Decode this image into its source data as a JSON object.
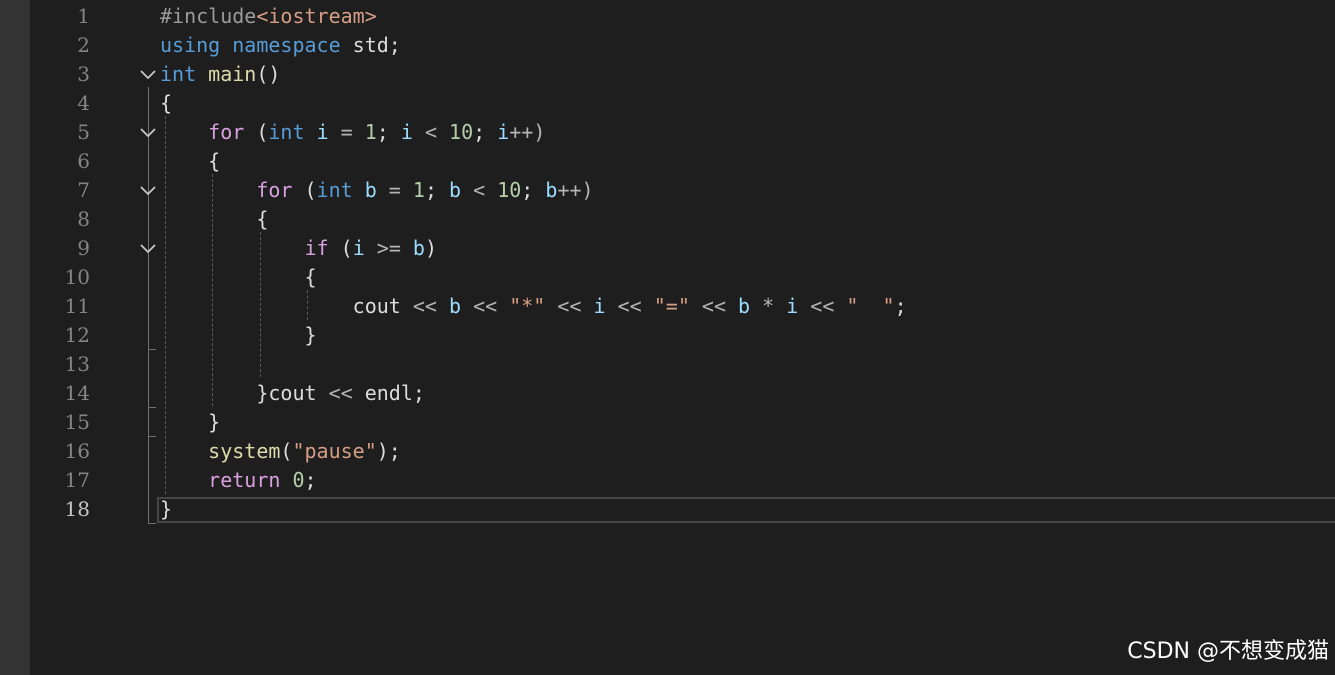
{
  "editor": {
    "active_line": 18,
    "line_numbers": [
      "1",
      "2",
      "3",
      "4",
      "5",
      "6",
      "7",
      "8",
      "9",
      "10",
      "11",
      "12",
      "13",
      "14",
      "15",
      "16",
      "17",
      "18"
    ],
    "lines": [
      [
        {
          "t": "#include",
          "c": "inc"
        },
        {
          "t": "<iostream>",
          "c": "str"
        }
      ],
      [
        {
          "t": "using",
          "c": "kw"
        },
        {
          "t": " ",
          "c": "plain"
        },
        {
          "t": "namespace",
          "c": "kw"
        },
        {
          "t": " std;",
          "c": "plain"
        }
      ],
      [
        {
          "t": "int",
          "c": "kw"
        },
        {
          "t": " ",
          "c": "plain"
        },
        {
          "t": "main",
          "c": "fn"
        },
        {
          "t": "()",
          "c": "punc"
        }
      ],
      [
        {
          "t": "{",
          "c": "punc"
        }
      ],
      [
        {
          "t": "    ",
          "c": "plain"
        },
        {
          "t": "for",
          "c": "ctl"
        },
        {
          "t": " (",
          "c": "punc"
        },
        {
          "t": "int",
          "c": "kw"
        },
        {
          "t": " ",
          "c": "plain"
        },
        {
          "t": "i",
          "c": "var"
        },
        {
          "t": " = ",
          "c": "op"
        },
        {
          "t": "1",
          "c": "num"
        },
        {
          "t": "; ",
          "c": "punc"
        },
        {
          "t": "i",
          "c": "var"
        },
        {
          "t": " < ",
          "c": "op"
        },
        {
          "t": "10",
          "c": "num"
        },
        {
          "t": "; ",
          "c": "punc"
        },
        {
          "t": "i",
          "c": "var"
        },
        {
          "t": "++)",
          "c": "op"
        }
      ],
      [
        {
          "t": "    {",
          "c": "punc"
        }
      ],
      [
        {
          "t": "        ",
          "c": "plain"
        },
        {
          "t": "for",
          "c": "ctl"
        },
        {
          "t": " (",
          "c": "punc"
        },
        {
          "t": "int",
          "c": "kw"
        },
        {
          "t": " ",
          "c": "plain"
        },
        {
          "t": "b",
          "c": "var"
        },
        {
          "t": " = ",
          "c": "op"
        },
        {
          "t": "1",
          "c": "num"
        },
        {
          "t": "; ",
          "c": "punc"
        },
        {
          "t": "b",
          "c": "var"
        },
        {
          "t": " < ",
          "c": "op"
        },
        {
          "t": "10",
          "c": "num"
        },
        {
          "t": "; ",
          "c": "punc"
        },
        {
          "t": "b",
          "c": "var"
        },
        {
          "t": "++)",
          "c": "op"
        }
      ],
      [
        {
          "t": "        {",
          "c": "punc"
        }
      ],
      [
        {
          "t": "            ",
          "c": "plain"
        },
        {
          "t": "if",
          "c": "ctl"
        },
        {
          "t": " (",
          "c": "punc"
        },
        {
          "t": "i",
          "c": "var"
        },
        {
          "t": " >= ",
          "c": "op"
        },
        {
          "t": "b",
          "c": "var"
        },
        {
          "t": ")",
          "c": "punc"
        }
      ],
      [
        {
          "t": "            {",
          "c": "punc"
        }
      ],
      [
        {
          "t": "                ",
          "c": "plain"
        },
        {
          "t": "cout",
          "c": "plain"
        },
        {
          "t": " << ",
          "c": "op"
        },
        {
          "t": "b",
          "c": "var"
        },
        {
          "t": " << ",
          "c": "op"
        },
        {
          "t": "\"*\"",
          "c": "str"
        },
        {
          "t": " << ",
          "c": "op"
        },
        {
          "t": "i",
          "c": "var"
        },
        {
          "t": " << ",
          "c": "op"
        },
        {
          "t": "\"=\"",
          "c": "str"
        },
        {
          "t": " << ",
          "c": "op"
        },
        {
          "t": "b",
          "c": "var"
        },
        {
          "t": " * ",
          "c": "op"
        },
        {
          "t": "i",
          "c": "var"
        },
        {
          "t": " << ",
          "c": "op"
        },
        {
          "t": "\"  \"",
          "c": "str"
        },
        {
          "t": ";",
          "c": "punc"
        }
      ],
      [
        {
          "t": "            }",
          "c": "punc"
        }
      ],
      [
        {
          "t": "",
          "c": "plain"
        }
      ],
      [
        {
          "t": "        }",
          "c": "punc"
        },
        {
          "t": "cout",
          "c": "plain"
        },
        {
          "t": " << ",
          "c": "op"
        },
        {
          "t": "endl",
          "c": "plain"
        },
        {
          "t": ";",
          "c": "punc"
        }
      ],
      [
        {
          "t": "    }",
          "c": "punc"
        }
      ],
      [
        {
          "t": "    ",
          "c": "plain"
        },
        {
          "t": "system",
          "c": "fn"
        },
        {
          "t": "(",
          "c": "punc"
        },
        {
          "t": "\"pause\"",
          "c": "str"
        },
        {
          "t": ");",
          "c": "punc"
        }
      ],
      [
        {
          "t": "    ",
          "c": "plain"
        },
        {
          "t": "return",
          "c": "ctl"
        },
        {
          "t": " ",
          "c": "plain"
        },
        {
          "t": "0",
          "c": "num"
        },
        {
          "t": ";",
          "c": "punc"
        }
      ],
      [
        {
          "t": "}",
          "c": "punc"
        }
      ]
    ],
    "fold_lines": [
      3,
      5,
      7,
      9
    ]
  },
  "watermark": "CSDN @不想变成猫"
}
